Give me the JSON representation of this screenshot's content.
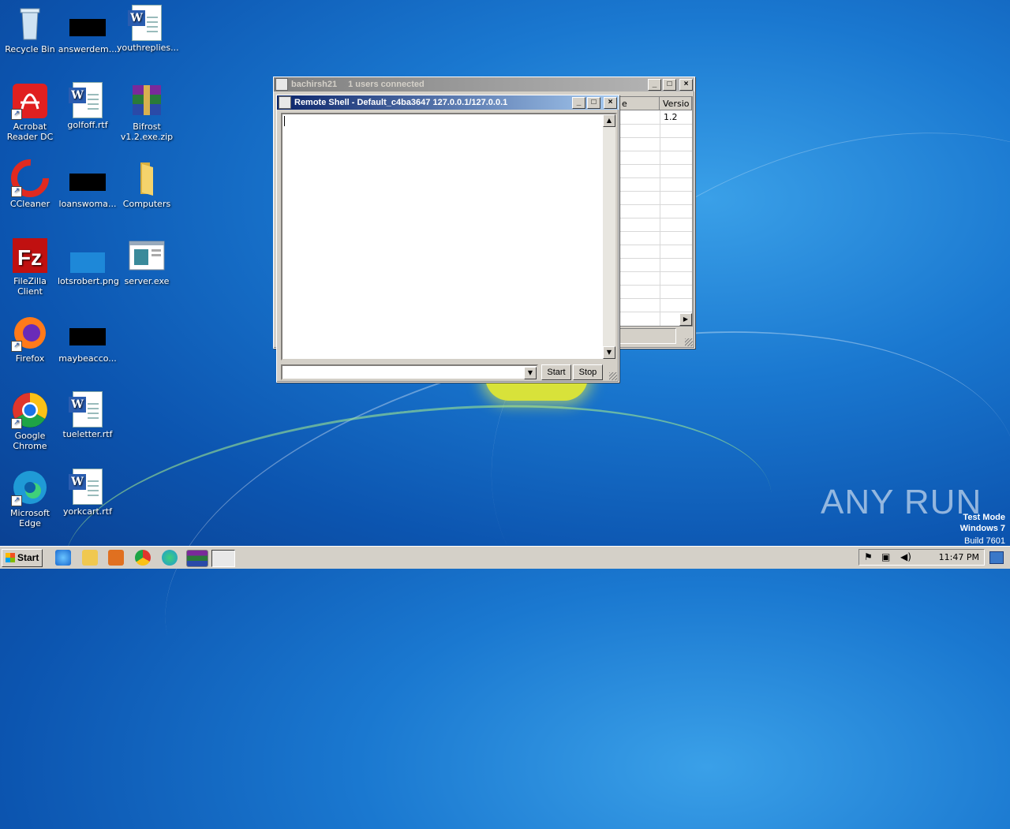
{
  "desktop": {
    "icons": [
      {
        "label": "Recycle Bin"
      },
      {
        "label": "answerdem..."
      },
      {
        "label": "youthreplies..."
      },
      {
        "label": "Acrobat Reader DC"
      },
      {
        "label": "golfoff.rtf"
      },
      {
        "label": "Bifrost v1.2.exe.zip"
      },
      {
        "label": "CCleaner"
      },
      {
        "label": "loanswoma..."
      },
      {
        "label": "Computers"
      },
      {
        "label": "FileZilla Client"
      },
      {
        "label": "lotsrobert.png"
      },
      {
        "label": "server.exe"
      },
      {
        "label": "Firefox"
      },
      {
        "label": "maybeacco..."
      },
      {
        "label": "Google Chrome"
      },
      {
        "label": "tueletter.rtf"
      },
      {
        "label": "Microsoft Edge"
      },
      {
        "label": "yorkcart.rtf"
      }
    ]
  },
  "bifrost_window": {
    "title": "bachirsh21",
    "status": "1 users connected",
    "columns": [
      "e",
      "Versio"
    ],
    "rows": [
      [
        "",
        "1.2"
      ]
    ]
  },
  "shell_window": {
    "title": "Remote Shell - Default_c4ba3647 127.0.0.1/127.0.0.1",
    "output": "",
    "command_value": "",
    "start_label": "Start",
    "stop_label": "Stop"
  },
  "watermark": {
    "brand": "ANY RUN",
    "line1": "Test Mode",
    "line2": "Windows 7",
    "line3": "Build 7601"
  },
  "taskbar": {
    "start_label": "Start",
    "clock": "11:47 PM"
  },
  "colors": {
    "title_active": "#0a246a",
    "title_inactive": "#808080",
    "desktop": "#1a78d0"
  }
}
